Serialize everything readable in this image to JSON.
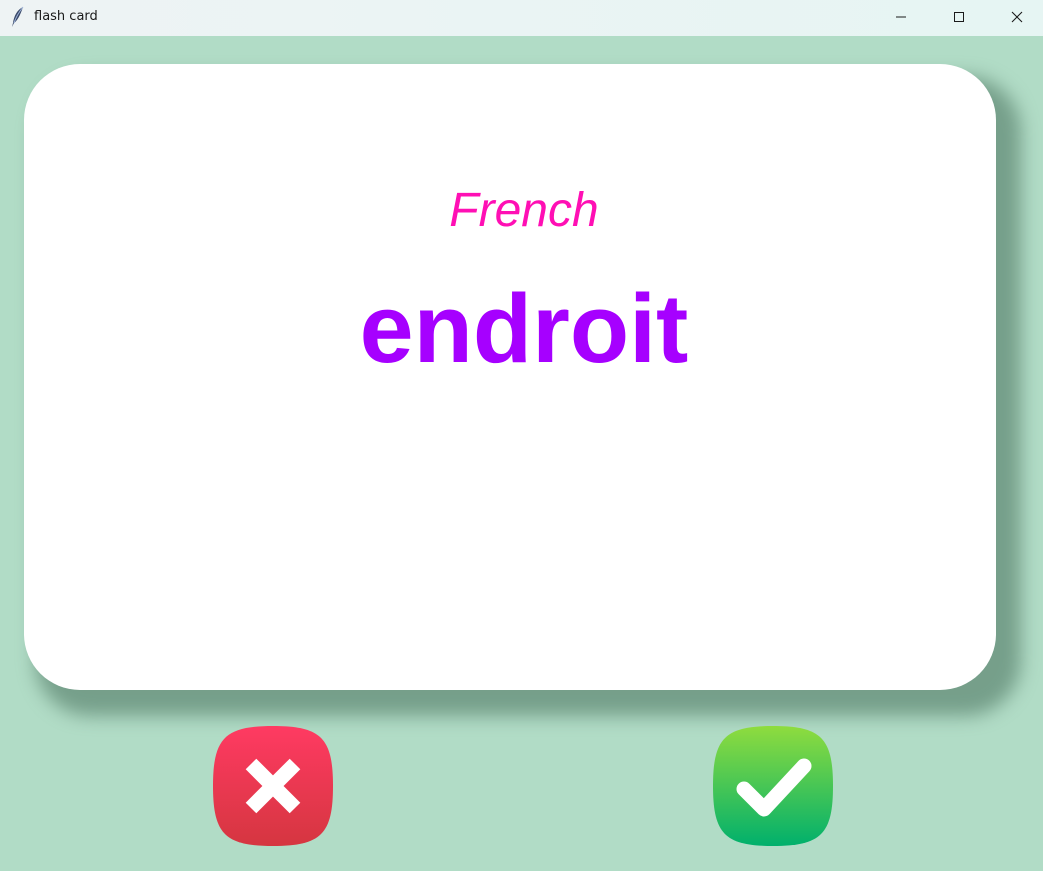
{
  "window": {
    "title": "flash card",
    "icon": "feather-icon",
    "controls": [
      "minimize-icon",
      "maximize-icon",
      "close-icon"
    ]
  },
  "card": {
    "language": "French",
    "word": "endroit"
  },
  "buttons": {
    "wrong_icon": "x-cross-icon",
    "right_icon": "checkmark-icon"
  },
  "colors": {
    "background": "#b1dcc6",
    "card": "#ffffff",
    "language_text": "#ff0fb4",
    "word_text": "#a600ff",
    "wrong_button": "#e8384f",
    "right_button": "#2ec45a"
  }
}
